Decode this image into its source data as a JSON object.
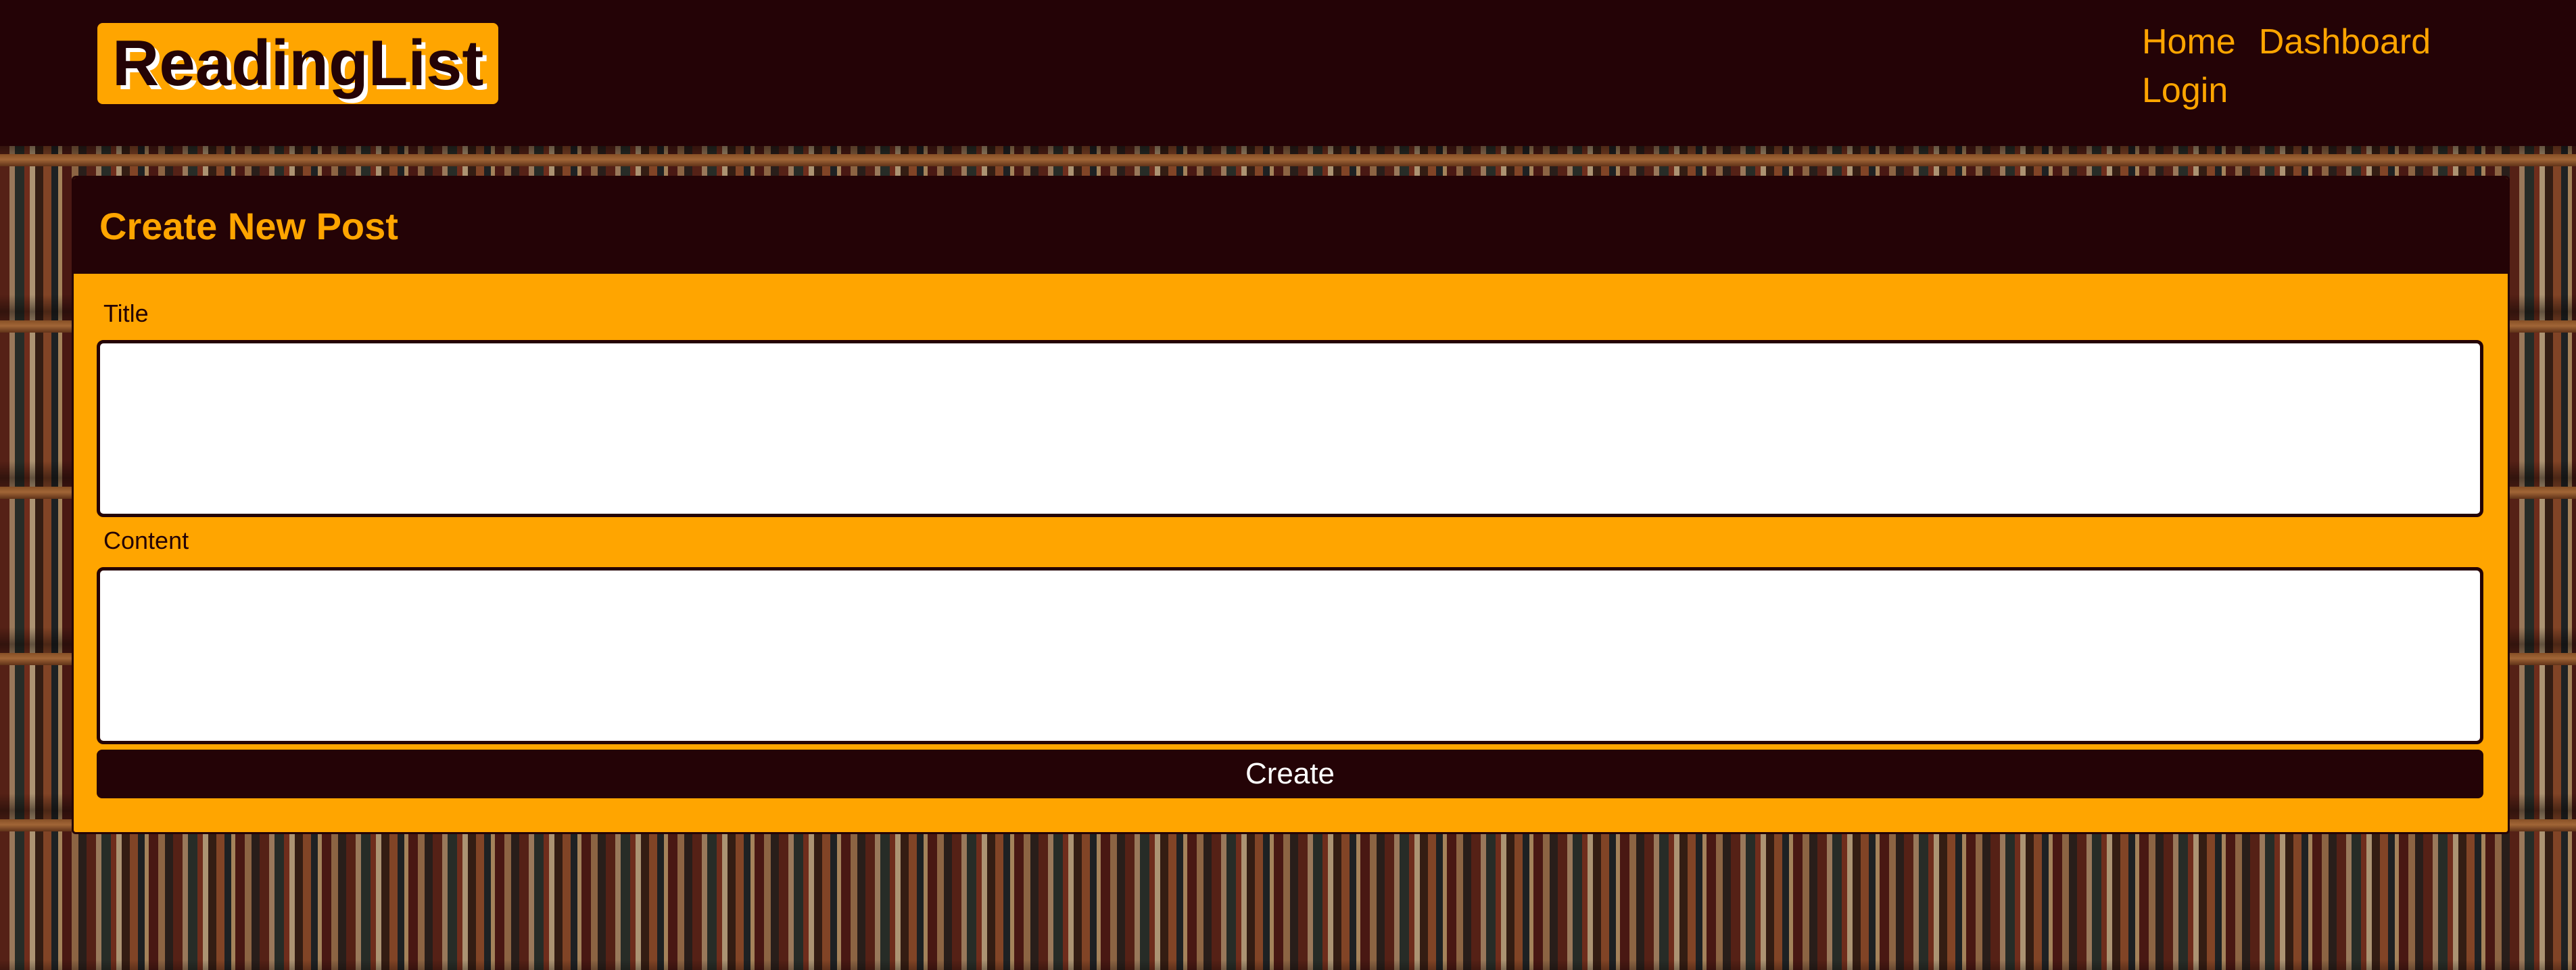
{
  "header": {
    "logo_text": "ReadingList",
    "nav": {
      "home": "Home",
      "dashboard": "Dashboard",
      "login": "Login"
    }
  },
  "form": {
    "heading": "Create New Post",
    "title_label": "Title",
    "title_value": "",
    "content_label": "Content",
    "content_value": "",
    "submit_label": "Create"
  },
  "colors": {
    "primary_dark": "#240306",
    "accent_orange": "#ffa500",
    "input_bg": "#ffffff"
  }
}
